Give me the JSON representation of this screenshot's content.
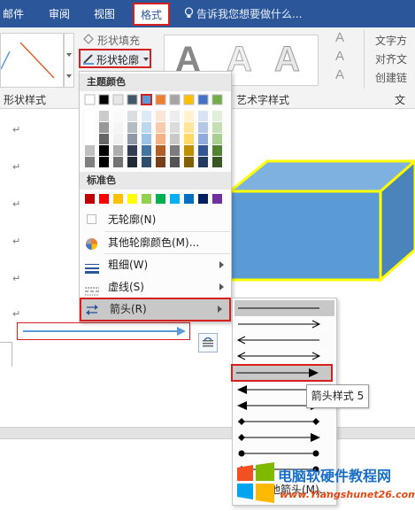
{
  "tabs": [
    "邮件",
    "审阅",
    "视图",
    "格式"
  ],
  "tell_me": "告诉我您想要做什么...",
  "ribbon": {
    "shape_fill": "形状填充",
    "shape_outline": "形状轮廓",
    "shape_styles_group": "形状样式",
    "art_styles_group": "艺术字样式",
    "text_group": "文本",
    "text_direction": "文字方",
    "align_text": "对齐文",
    "create_link": "创建链",
    "wordart_letter": "A"
  },
  "menu": {
    "theme_colors": "主题颜色",
    "standard_colors": "标准色",
    "no_outline": "无轮廓(N)",
    "more_colors": "其他轮廓颜色(M)...",
    "weight": "粗细(W)",
    "dashes": "虚线(S)",
    "arrows": "箭头(R)"
  },
  "colors": {
    "theme_row": [
      "#ffffff",
      "#000000",
      "#e7e6e6",
      "#44546a",
      "#5b9bd5",
      "#ed7d31",
      "#a5a5a5",
      "#ffc000",
      "#4472c4",
      "#70ad47"
    ],
    "standard_row": [
      "#c00000",
      "#ff0000",
      "#ffc000",
      "#ffff00",
      "#92d050",
      "#00b050",
      "#00b0f0",
      "#0070c0",
      "#002060",
      "#7030a0"
    ],
    "accent": "#2b579a",
    "highlight_red": "#d62020",
    "cube_fill": "#5b9bd5",
    "cube_outline": "#ffff00"
  },
  "submenu": {
    "more_arrows": "其他箭头(M)..."
  },
  "tooltip": "箭头样式 5",
  "watermark": {
    "title": "电脑软硬件教程网",
    "url": "www.Yiangshunet26.com"
  },
  "paragraph_mark": "↵"
}
